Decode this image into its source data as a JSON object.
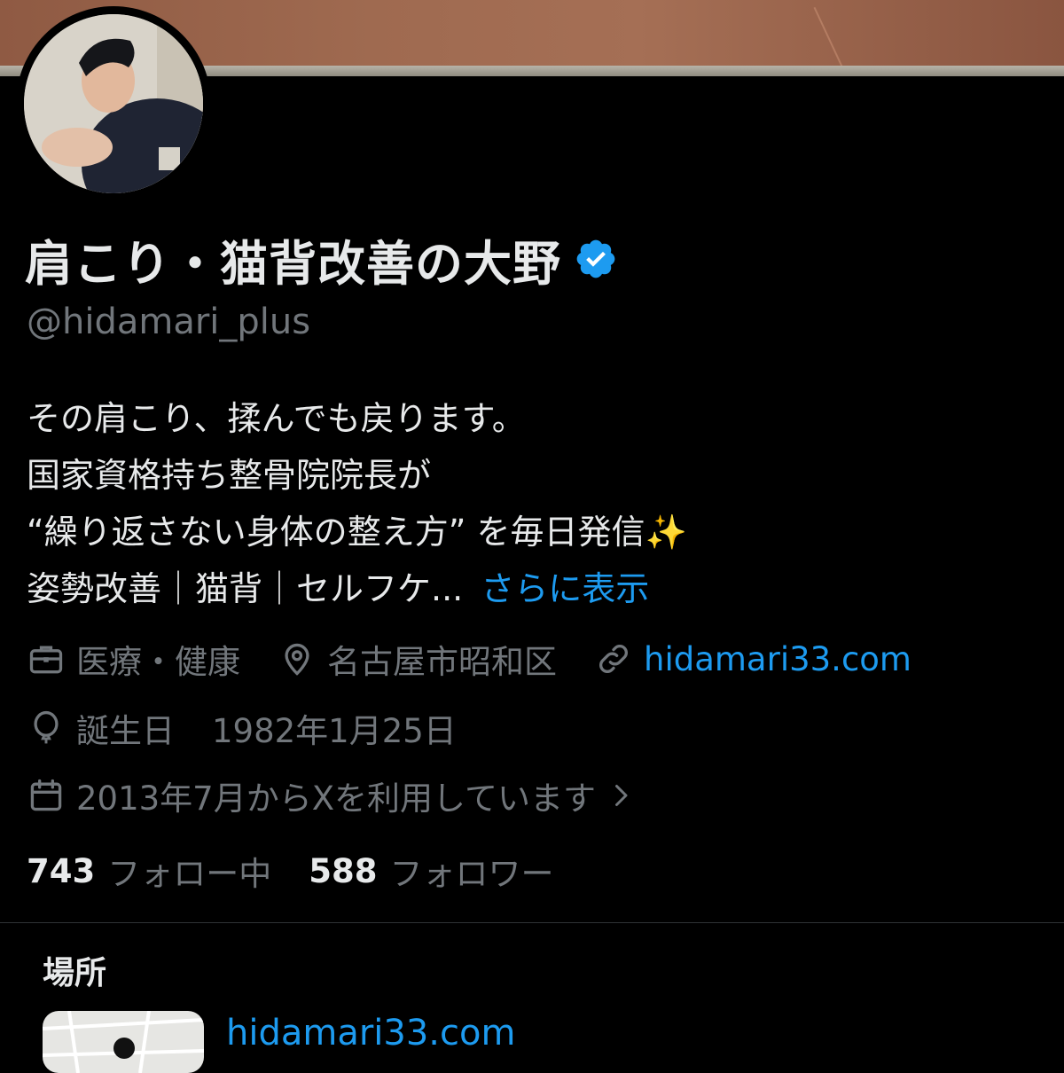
{
  "profile": {
    "display_name": "肩こり・猫背改善の大野",
    "handle": "@hidamari_plus",
    "verified_icon": "verified-badge-icon",
    "bio_lines": [
      "その肩こり、揉んでも戻ります。",
      "国家資格持ち整骨院院長が",
      "“繰り返さない身体の整え方” を毎日発信",
      "姿勢改善｜猫背｜セルフケ..."
    ],
    "bio_sparkle": "✨",
    "show_more": "さらに表示",
    "category": "医療・健康",
    "location": "名古屋市昭和区",
    "website": "hidamari33.com",
    "birthday_label": "誕生日",
    "birthday_value": "1982年1月25日",
    "joined": "2013年7月からXを利用しています",
    "following_count": "743",
    "following_label": "フォロー中",
    "followers_count": "588",
    "followers_label": "フォロワー"
  },
  "place_section": {
    "title": "場所",
    "link": "hidamari33.com"
  },
  "colors": {
    "background": "#000000",
    "text_primary": "#e7e9ea",
    "text_secondary": "#71767b",
    "accent": "#1d9bf0"
  }
}
